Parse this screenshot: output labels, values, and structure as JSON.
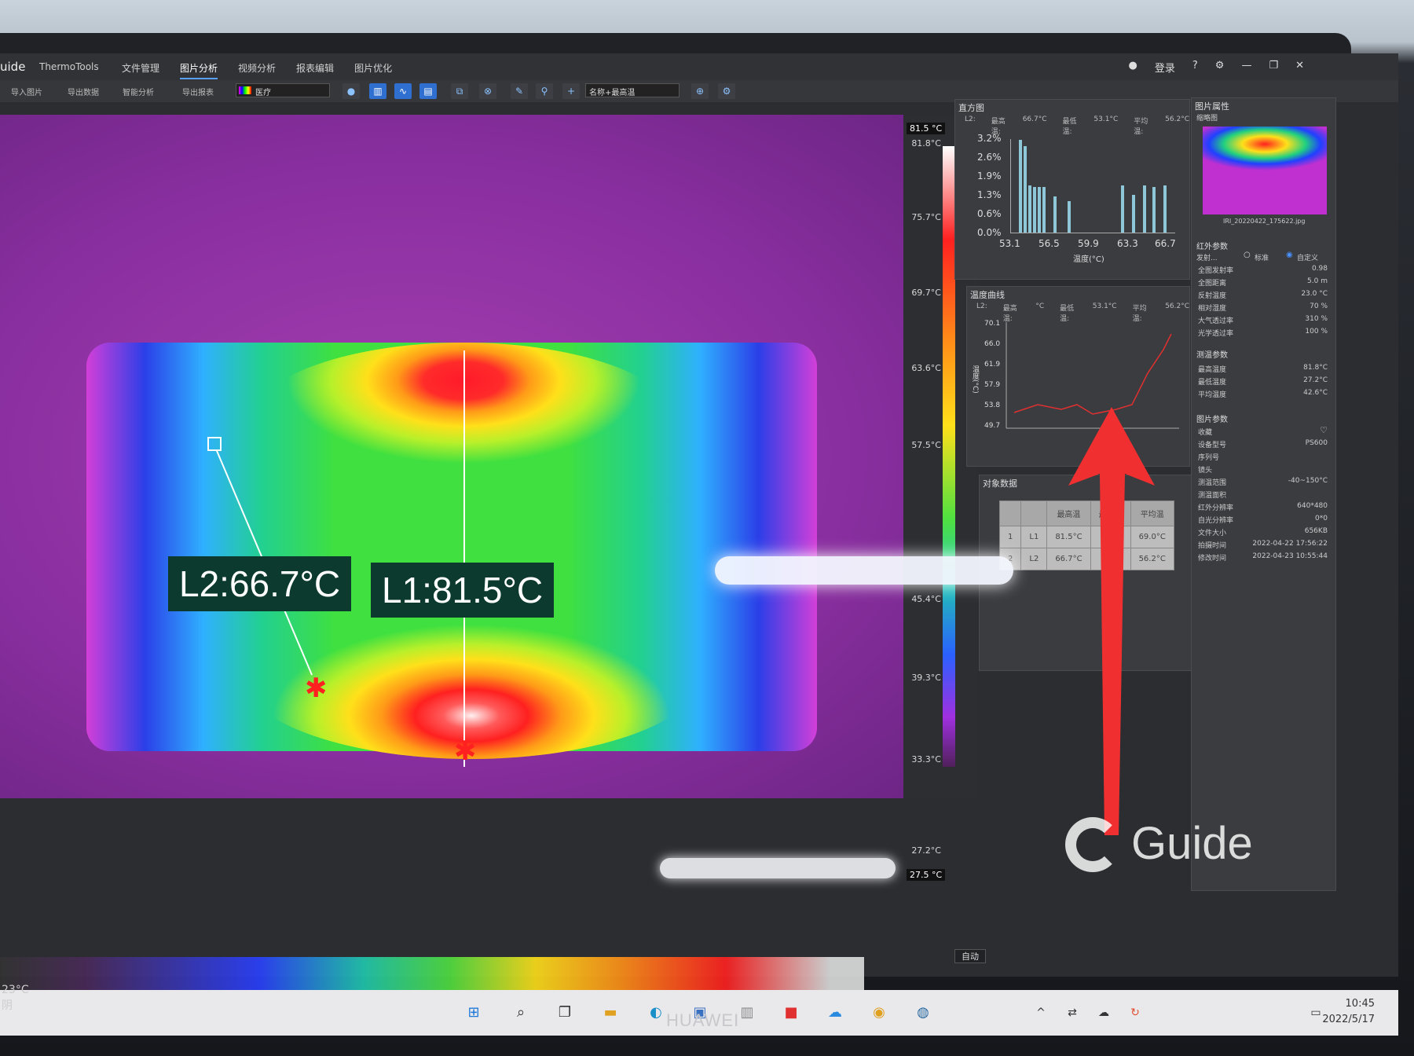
{
  "app": {
    "logo": "uide",
    "name": "ThermoTools",
    "menu": [
      "文件管理",
      "图片分析",
      "视频分析",
      "报表编辑",
      "图片优化"
    ],
    "active_menu": "图片分析",
    "login": "登录"
  },
  "toolbar": {
    "buttons": [
      "导入图片",
      "导出数据",
      "智能分析",
      "导出报表"
    ],
    "palette": "医疗",
    "mode": "名称+最高温"
  },
  "thermal": {
    "label_l2": "L2:66.7°C",
    "label_l1": "L1:81.5°C"
  },
  "scale": {
    "max_box": "81.5 °C",
    "min_box": "27.5 °C",
    "ticks": [
      "81.8°C",
      "75.7°C",
      "69.7°C",
      "63.6°C",
      "57.5°C",
      "45.4°C",
      "39.3°C",
      "33.3°C",
      "27.2°C"
    ],
    "auto": "自动"
  },
  "histogram": {
    "title": "直方图",
    "stats": [
      "L2:",
      "最高温:",
      "66.7°C",
      "最低温:",
      "53.1°C",
      "平均温:",
      "56.2°C"
    ],
    "y_ticks": [
      "3.2%",
      "2.6%",
      "1.9%",
      "1.3%",
      "0.6%",
      "0.0%"
    ],
    "x_ticks": [
      "53.1",
      "56.5",
      "59.9",
      "63.3",
      "66.7"
    ],
    "xlabel": "温度(°C)"
  },
  "curve": {
    "title": "温度曲线",
    "stats": [
      "L2:",
      "最高温:",
      "°C",
      "最低温:",
      "53.1°C",
      "平均温:",
      "56.2°C"
    ],
    "y_ticks": [
      "70.1",
      "66.0",
      "61.9",
      "57.9",
      "53.8",
      "49.7"
    ],
    "ylabel": "温度(°C)"
  },
  "objects": {
    "title": "对象数据",
    "headers": [
      "",
      "",
      "最高温",
      "最低温",
      "平均温"
    ],
    "rows": [
      [
        "1",
        "L1",
        "81.5°C",
        "°C",
        "69.0°C"
      ],
      [
        "2",
        "L2",
        "66.7°C",
        ".1°C",
        "56.2°C"
      ]
    ]
  },
  "props": {
    "title": "图片属性",
    "thumb_title": "缩略图",
    "filename": "IRI_20220422_175622.jpg",
    "ir_title": "红外参数",
    "ir_emis_label": "发射...",
    "ir_opt1": "标准",
    "ir_opt2": "自定义",
    "ir_rows": [
      [
        "全图发射率",
        "0.98"
      ],
      [
        "全图距离",
        "5.0 m"
      ],
      [
        "反射温度",
        "23.0 °C"
      ],
      [
        "相对湿度",
        "70 %"
      ],
      [
        "大气透过率",
        "310 %"
      ],
      [
        "光学透过率",
        "100 %"
      ]
    ],
    "meas_title": "测温参数",
    "meas_rows": [
      [
        "最高温度",
        "81.8°C"
      ],
      [
        "最低温度",
        "27.2°C"
      ],
      [
        "平均温度",
        "42.6°C"
      ]
    ],
    "img_title": "图片参数",
    "img_rows": [
      [
        "收藏",
        ""
      ],
      [
        "设备型号",
        "PS600"
      ],
      [
        "序列号",
        ""
      ],
      [
        "镜头",
        ""
      ],
      [
        "测温范围",
        "-40~150°C"
      ],
      [
        "测温面积",
        ""
      ],
      [
        "红外分辨率",
        "640*480"
      ],
      [
        "自光分辨率",
        "0*0"
      ],
      [
        "文件大小",
        "656KB"
      ],
      [
        "拍摄时间",
        "2022-04-22 17:56:22"
      ],
      [
        "修改时间",
        "2022-04-23 10:55:44"
      ]
    ]
  },
  "taskbar": {
    "time": "10:45",
    "date": "2022/5/17"
  },
  "weather": {
    "temp": "23°C",
    "cond": "阴"
  },
  "watermark": "Guide",
  "brand": "HUAWEI",
  "colors": {
    "accent": "#2f6fd0",
    "label_bg": "#0d3a2e",
    "arrow": "#f03030"
  }
}
